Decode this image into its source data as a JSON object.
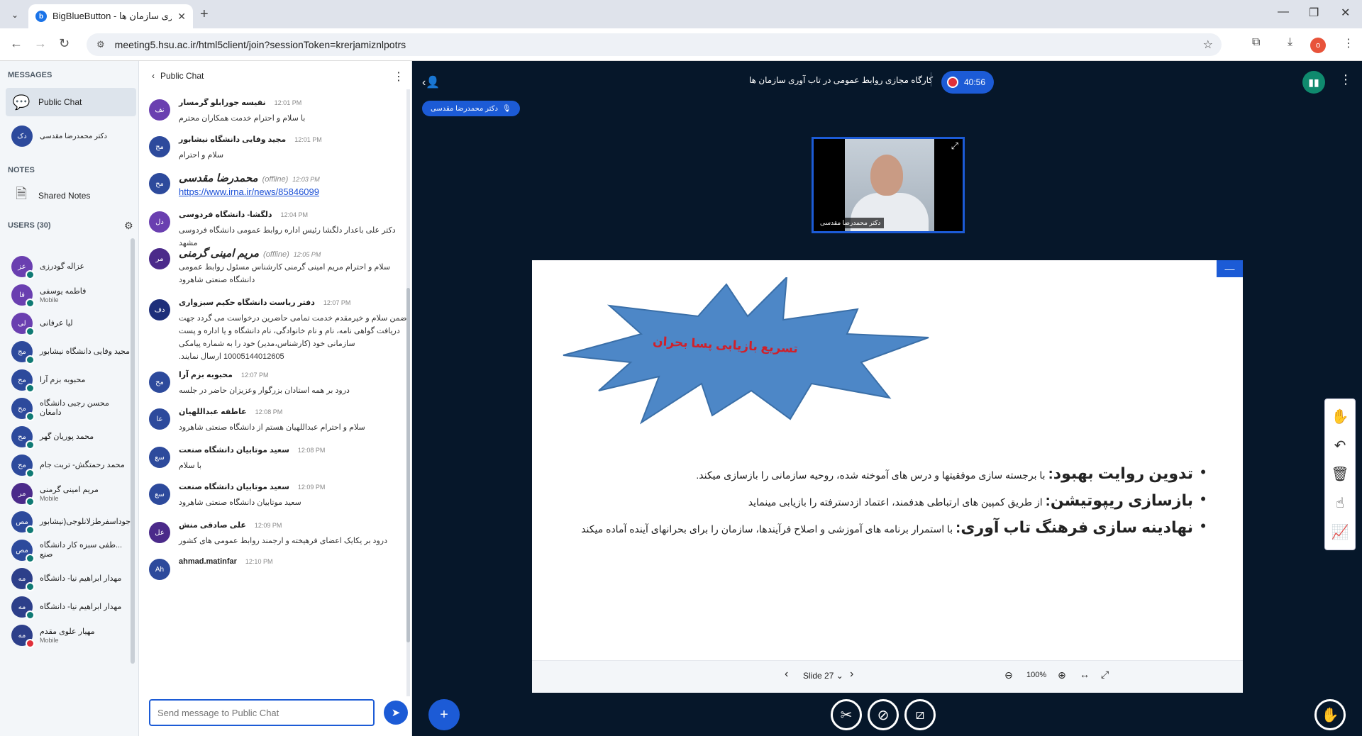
{
  "browser": {
    "tab_title": "BigBlueButton - آوری سازمان ها",
    "favicon": "b",
    "url": "meeting5.hsu.ac.ir/html5client/join?sessionToken=krerjamiznlpotrs",
    "profile_initial": "o"
  },
  "sidebar": {
    "messages_heading": "MESSAGES",
    "public_chat": "Public Chat",
    "private_chat_name": "دکتر محمدرضا مقدسی",
    "private_chat_initials": "دک",
    "notes_heading": "NOTES",
    "shared_notes": "Shared Notes",
    "users_heading": "USERS (30)",
    "users": [
      {
        "name": "عزاله گودرزی",
        "initials": "عز",
        "color": "#6a3fb0",
        "status": "teal",
        "sub": ""
      },
      {
        "name": "فاطمه یوسفی",
        "initials": "فا",
        "color": "#6a3fb0",
        "status": "teal",
        "sub": "Mobile"
      },
      {
        "name": "لیا عرفانی",
        "initials": "لی",
        "color": "#6a3fb0",
        "status": "teal",
        "sub": ""
      },
      {
        "name": "مجید وفایی دانشگاه نیشابور",
        "initials": "مج",
        "color": "#2d4a9c",
        "status": "teal",
        "sub": ""
      },
      {
        "name": "محبوبه بزم آرا",
        "initials": "مح",
        "color": "#2d4a9c",
        "status": "teal",
        "sub": ""
      },
      {
        "name": "محسن رجبی دانشگاه دامغان",
        "initials": "مح",
        "color": "#2d4a9c",
        "status": "teal",
        "sub": ""
      },
      {
        "name": "محمد پوریان گهر",
        "initials": "مح",
        "color": "#2d4a9c",
        "status": "teal",
        "sub": ""
      },
      {
        "name": "محمد رحمتگش- تربت جام",
        "initials": "مح",
        "color": "#2d4a9c",
        "status": "teal",
        "sub": ""
      },
      {
        "name": "مریم امینی گرمنی",
        "initials": "مر",
        "color": "#4b2a8a",
        "status": "teal",
        "sub": "Mobile"
      },
      {
        "name": "...جوداسفرطزلانلوجی(نیشابور",
        "initials": "مص",
        "color": "#2d4a9c",
        "status": "teal",
        "sub": ""
      },
      {
        "name": "...طفی سبزه کار دانشگاه صنع",
        "initials": "مص",
        "color": "#2d4a9c",
        "status": "teal",
        "sub": ""
      },
      {
        "name": "مهدار ابراهیم نیا- دانشگاه",
        "initials": "مه",
        "color": "#2d3f8a",
        "status": "teal",
        "sub": ""
      },
      {
        "name": "مهدار ابراهیم نیا- دانشگاه",
        "initials": "مه",
        "color": "#2d3f8a",
        "status": "teal",
        "sub": ""
      },
      {
        "name": "مهیار علوی مقدم",
        "initials": "مه",
        "color": "#2d3f8a",
        "status": "red",
        "sub": "Mobile"
      }
    ]
  },
  "chat": {
    "title": "Public Chat",
    "input_placeholder": "Send message to Public Chat",
    "messages": [
      {
        "name": "نفیسه جورابلو گرمسار",
        "time": "12:01 PM",
        "initials": "نف",
        "color": "#6a3fb0",
        "offline": "",
        "text": "با سلام و احترام خدمت همکاران محترم",
        "big": false,
        "link": false
      },
      {
        "name": "مجید وفایی دانشگاه نیشابور",
        "time": "12:01 PM",
        "initials": "مج",
        "color": "#2d4a9c",
        "offline": "",
        "text": "سلام و احترام",
        "big": false,
        "link": false
      },
      {
        "name": "محمدرضا مقدسی",
        "time": "12:03 PM",
        "initials": "مح",
        "color": "#2d4a9c",
        "offline": "(offline)",
        "text": "https://www.irna.ir/news/85846099",
        "big": true,
        "link": true
      },
      {
        "name": "دلگشا- دانشگاه فردوسی",
        "time": "12:04 PM",
        "initials": "دل",
        "color": "#6a3fb0",
        "offline": "",
        "text": "دکتر علی باعدار دلگشا رئیس اداره روابط عمومی دانشگاه فردوسی مشهد",
        "big": false,
        "link": false
      },
      {
        "name": "مریم امینی گرمنی",
        "time": "12:05 PM",
        "initials": "مر",
        "color": "#4b2a8a",
        "offline": "(offline)",
        "text": "سلام و احترام مریم امینی گرمنی کارشناس مسئول روابط عمومی دانشگاه صنعتی شاهرود",
        "big": true,
        "link": false
      },
      {
        "name": "دفتر ریاست دانشگاه حکیم سبزواری",
        "time": "12:07 PM",
        "initials": "دف",
        "color": "#1e2f7a",
        "offline": "",
        "text": "ضمن سلام و خیرمقدم خدمت تمامی حاضرین درخواست می گردد جهت دریافت گواهی نامه، نام و نام خانوادگی، نام دانشگاه و یا اداره و پست سازمانی خود (کارشناس،مدیر) خود را به شماره پیامکی 10005144012605 ارسال نمایند.",
        "big": false,
        "link": false
      },
      {
        "name": "محبوبه بزم آرا",
        "time": "12:07 PM",
        "initials": "مح",
        "color": "#2d4a9c",
        "offline": "",
        "text": "درود بر همه استادان بزرگوار وعزیزان حاضر در جلسه",
        "big": false,
        "link": false
      },
      {
        "name": "عاطفه عبداللهیان",
        "time": "12:08 PM",
        "initials": "عا",
        "color": "#2d4a9c",
        "offline": "",
        "text": "سلام و احترام عبداللهیان هستم از دانشگاه صنعتی شاهرود",
        "big": false,
        "link": false
      },
      {
        "name": "سعید موتابیان دانشگاه صنعت",
        "time": "12:08 PM",
        "initials": "سع",
        "color": "#2d4a9c",
        "offline": "",
        "text": "با سلام",
        "big": false,
        "link": false
      },
      {
        "name": "سعید موتابیان دانشگاه صنعت",
        "time": "12:09 PM",
        "initials": "سع",
        "color": "#2d4a9c",
        "offline": "",
        "text": "سعید موتابیان دانشگاه صنعتی شاهرود",
        "big": false,
        "link": false
      },
      {
        "name": "علی صادقی منش",
        "time": "12:09 PM",
        "initials": "عل",
        "color": "#4b2a8a",
        "offline": "",
        "text": "درود بر یکایک اعضای فرهیخته و ارجمند روابط عمومی های کشور",
        "big": false,
        "link": false
      },
      {
        "name": "ahmad.matinfar",
        "time": "12:10 PM",
        "initials": "Ah",
        "color": "#2d4a9c",
        "offline": "",
        "text": "",
        "big": false,
        "link": false
      }
    ]
  },
  "main": {
    "meeting_title": "کارگاه مجازی روابط عمومی در تاب آوری سازمان ها",
    "timer": "40:56",
    "talker": "دکتر محمدرضا مقدسی",
    "video_label": "دکتر محمدرضا مقدسی",
    "slide": {
      "burst_text": "تسریع بازیابی پسا بحران",
      "bullets": [
        {
          "title": "تدوین روایت بهبود:",
          "text": " با برجسته سازی موفقیتها و درس های آموخته شده، روحیه سازمانی را بازسازی میکند."
        },
        {
          "title": "بازسازی ریپوتیشن:",
          "text": " از طریق کمپین های ارتباطی هدفمند، اعتماد ازدسترفته را بازیابی مینماید"
        },
        {
          "title": "نهادینه سازی فرهنگ تاب آوری:",
          "text": "  با استمرار برنامه های آموزشی و اصلاح فرآیندها، سازمان را برای بحرانهای آینده آماده میکند"
        }
      ]
    },
    "slide_label": "Slide 27",
    "zoom": "100%"
  },
  "colors": {
    "accent": "#1c5bd6",
    "main_bg": "#06172a"
  }
}
